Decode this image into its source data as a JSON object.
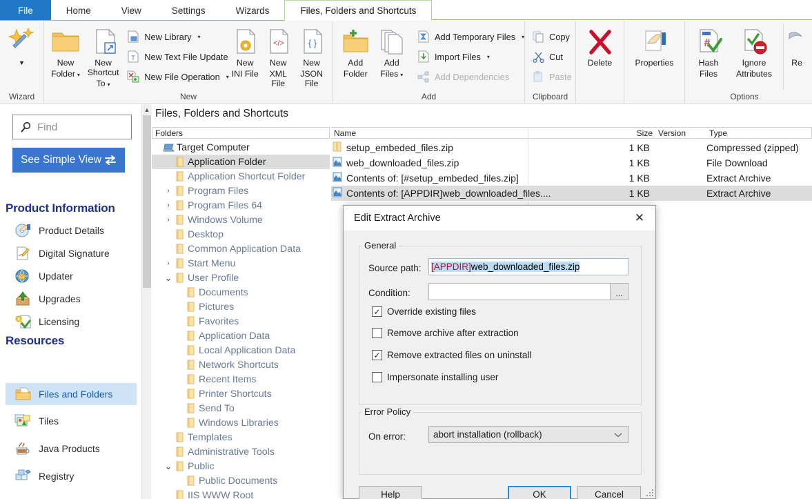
{
  "ribbon": {
    "tabs": [
      {
        "label": "File",
        "state": "file"
      },
      {
        "label": "Home",
        "state": "normal"
      },
      {
        "label": "View",
        "state": "normal"
      },
      {
        "label": "Settings",
        "state": "normal"
      },
      {
        "label": "Wizards",
        "state": "normal"
      },
      {
        "label": "Files, Folders and Shortcuts",
        "state": "active"
      }
    ],
    "groups": {
      "wizard": {
        "label": "Wizard",
        "button": {
          "label": "",
          "icon": "wizard-wand-icon",
          "caret": "▼"
        }
      },
      "new": {
        "label": "New",
        "new_folder": {
          "line1": "New",
          "line2": "Folder",
          "caret": "▾"
        },
        "new_shortcut_to": {
          "line1": "New Shortcut",
          "line2": "To",
          "caret": "▾"
        },
        "new_library": {
          "label": "New Library",
          "caret": "▾"
        },
        "new_text_file_update": {
          "label": "New Text File Update"
        },
        "new_file_operation": {
          "label": "New File Operation",
          "caret": "▾"
        },
        "new_ini_file": {
          "line1": "New",
          "line2": "INI File"
        },
        "new_xml_file": {
          "line1": "New",
          "line2": "XML File"
        },
        "new_json_file": {
          "line1": "New",
          "line2": "JSON File"
        }
      },
      "add": {
        "label": "Add",
        "add_folder": {
          "line1": "Add",
          "line2": "Folder"
        },
        "add_files": {
          "line1": "Add",
          "line2": "Files",
          "caret": "▾"
        },
        "add_temporary_files": {
          "label": "Add Temporary Files",
          "caret": "▾"
        },
        "import_files": {
          "label": "Import Files",
          "caret": "▾"
        },
        "add_dependencies": {
          "label": "Add Dependencies",
          "disabled": true
        }
      },
      "clipboard": {
        "label": "Clipboard",
        "copy": {
          "label": "Copy"
        },
        "cut": {
          "label": "Cut"
        },
        "paste": {
          "label": "Paste",
          "disabled": true
        }
      },
      "delete": {
        "label": "Delete"
      },
      "properties": {
        "label": "Properties"
      },
      "options": {
        "label": "Options",
        "hash_files": {
          "line1": "Hash",
          "line2": "Files"
        },
        "ignore_attributes": {
          "line1": "Ignore",
          "line2": "Attributes"
        },
        "truncated": {
          "line1": "",
          "line2": "Re"
        }
      }
    }
  },
  "sidebar": {
    "search": {
      "placeholder": "Find",
      "value": "",
      "icon": "search-icon"
    },
    "simple_view_button": {
      "label": "See Simple View",
      "icon": "swap-arrows-icon"
    },
    "sections": [
      {
        "heading": "Product Information",
        "items": [
          {
            "label": "Product Details",
            "icon": "disc-hand-icon",
            "selected": false
          },
          {
            "label": "Digital Signature",
            "icon": "signature-pen-icon",
            "selected": false
          },
          {
            "label": "Updater",
            "icon": "globe-updater-icon",
            "selected": false
          },
          {
            "label": "Upgrades",
            "icon": "box-upgrade-icon",
            "selected": false
          },
          {
            "label": "Licensing",
            "icon": "key-check-icon",
            "selected": false
          }
        ]
      },
      {
        "heading": "Resources",
        "items": [
          {
            "label": "Files and Folders",
            "icon": "folder-file-icon",
            "selected": true
          },
          {
            "label": "Tiles",
            "icon": "tiles-images-icon",
            "selected": false
          },
          {
            "label": "Java Products",
            "icon": "coffee-cup-icon",
            "selected": false
          },
          {
            "label": "Registry",
            "icon": "registry-blocks-icon",
            "selected": false
          }
        ]
      }
    ]
  },
  "main": {
    "panel_title": "Files, Folders and Shortcuts",
    "tree_header": "Folders",
    "list_headers": {
      "name": "Name",
      "size": "Size",
      "version": "Version",
      "type": "Type"
    },
    "tree": [
      {
        "label": "Target Computer",
        "indent": 0,
        "twisty": "",
        "icon": "computer-icon",
        "selected": false,
        "root": true
      },
      {
        "label": "Application Folder",
        "indent": 1,
        "twisty": "",
        "icon": "folder-icon",
        "selected": true,
        "root": false
      },
      {
        "label": "Application Shortcut Folder",
        "indent": 1,
        "twisty": "",
        "icon": "folder-icon",
        "selected": false,
        "root": false
      },
      {
        "label": "Program Files",
        "indent": 1,
        "twisty": "›",
        "icon": "folder-icon",
        "selected": false,
        "root": false
      },
      {
        "label": "Program Files 64",
        "indent": 1,
        "twisty": "›",
        "icon": "folder-icon",
        "selected": false,
        "root": false
      },
      {
        "label": "Windows Volume",
        "indent": 1,
        "twisty": "›",
        "icon": "folder-icon",
        "selected": false,
        "root": false
      },
      {
        "label": "Desktop",
        "indent": 1,
        "twisty": "",
        "icon": "folder-icon",
        "selected": false,
        "root": false
      },
      {
        "label": "Common Application Data",
        "indent": 1,
        "twisty": "",
        "icon": "folder-icon",
        "selected": false,
        "root": false
      },
      {
        "label": "Start Menu",
        "indent": 1,
        "twisty": "›",
        "icon": "folder-icon",
        "selected": false,
        "root": false
      },
      {
        "label": "User Profile",
        "indent": 1,
        "twisty": "⌄",
        "icon": "folder-icon",
        "selected": false,
        "root": false
      },
      {
        "label": "Documents",
        "indent": 2,
        "twisty": "",
        "icon": "folder-icon",
        "selected": false,
        "root": false
      },
      {
        "label": "Pictures",
        "indent": 2,
        "twisty": "",
        "icon": "folder-icon",
        "selected": false,
        "root": false
      },
      {
        "label": "Favorites",
        "indent": 2,
        "twisty": "",
        "icon": "folder-icon",
        "selected": false,
        "root": false
      },
      {
        "label": "Application Data",
        "indent": 2,
        "twisty": "",
        "icon": "folder-icon",
        "selected": false,
        "root": false
      },
      {
        "label": "Local Application Data",
        "indent": 2,
        "twisty": "",
        "icon": "folder-icon",
        "selected": false,
        "root": false
      },
      {
        "label": "Network Shortcuts",
        "indent": 2,
        "twisty": "",
        "icon": "folder-icon",
        "selected": false,
        "root": false
      },
      {
        "label": "Recent Items",
        "indent": 2,
        "twisty": "",
        "icon": "folder-icon",
        "selected": false,
        "root": false
      },
      {
        "label": "Printer Shortcuts",
        "indent": 2,
        "twisty": "",
        "icon": "folder-icon",
        "selected": false,
        "root": false
      },
      {
        "label": "Send To",
        "indent": 2,
        "twisty": "",
        "icon": "folder-icon",
        "selected": false,
        "root": false
      },
      {
        "label": "Windows Libraries",
        "indent": 2,
        "twisty": "",
        "icon": "folder-icon",
        "selected": false,
        "root": false
      },
      {
        "label": "Templates",
        "indent": 1,
        "twisty": "",
        "icon": "folder-icon",
        "selected": false,
        "root": false
      },
      {
        "label": "Administrative Tools",
        "indent": 1,
        "twisty": "",
        "icon": "folder-icon",
        "selected": false,
        "root": false
      },
      {
        "label": "Public",
        "indent": 1,
        "twisty": "⌄",
        "icon": "folder-icon",
        "selected": false,
        "root": false
      },
      {
        "label": "Public Documents",
        "indent": 2,
        "twisty": "",
        "icon": "folder-icon",
        "selected": false,
        "root": false
      },
      {
        "label": "IIS WWW Root",
        "indent": 1,
        "twisty": "",
        "icon": "folder-icon",
        "selected": false,
        "root": false
      }
    ],
    "files": [
      {
        "name": "setup_embeded_files.zip",
        "size": "1 KB",
        "version": "",
        "type": "Compressed (zipped)",
        "icon": "zip-folder-icon",
        "selected": false
      },
      {
        "name": "web_downloaded_files.zip",
        "size": "1 KB",
        "version": "",
        "type": "File Download",
        "icon": "download-file-icon",
        "selected": false
      },
      {
        "name": "Contents of: [#setup_embeded_files.zip]",
        "size": "1 KB",
        "version": "",
        "type": "Extract Archive",
        "icon": "extract-archive-icon",
        "selected": false
      },
      {
        "name": "Contents of: [APPDIR]web_downloaded_files....",
        "size": "1 KB",
        "version": "",
        "type": "Extract Archive",
        "icon": "extract-archive-icon",
        "selected": true
      }
    ]
  },
  "dialog": {
    "title": "Edit Extract Archive",
    "close_icon": "close-icon",
    "general_group": "General",
    "source_path_label": "Source path:",
    "source_path_prop": "[APPDIR]",
    "source_path_rest": "web_downloaded_files.zip",
    "condition_label": "Condition:",
    "condition_value": "",
    "condition_browse": "...",
    "checkboxes": [
      {
        "label": "Override existing files",
        "checked": true
      },
      {
        "label": "Remove archive after extraction",
        "checked": false
      },
      {
        "label": "Remove extracted files on uninstall",
        "checked": true
      },
      {
        "label": "Impersonate installing user",
        "checked": false
      }
    ],
    "error_policy_group": "Error Policy",
    "on_error_label": "On error:",
    "on_error_value": "abort installation (rollback)",
    "buttons": {
      "help": "Help",
      "ok": "OK",
      "cancel": "Cancel"
    }
  },
  "colors": {
    "file_tab_blue": "#2079c7",
    "tab_accent_green": "#8dc673",
    "sidebar_accent": "#3a76d0",
    "section_heading": "#1f2f8c",
    "selection_gray": "#dcdcdc",
    "sidebar_selection": "#cfe3f7",
    "text_selection_blue": "#bcdcf4",
    "property_red": "#9b2335",
    "ok_border_blue": "#2a8ad4"
  }
}
